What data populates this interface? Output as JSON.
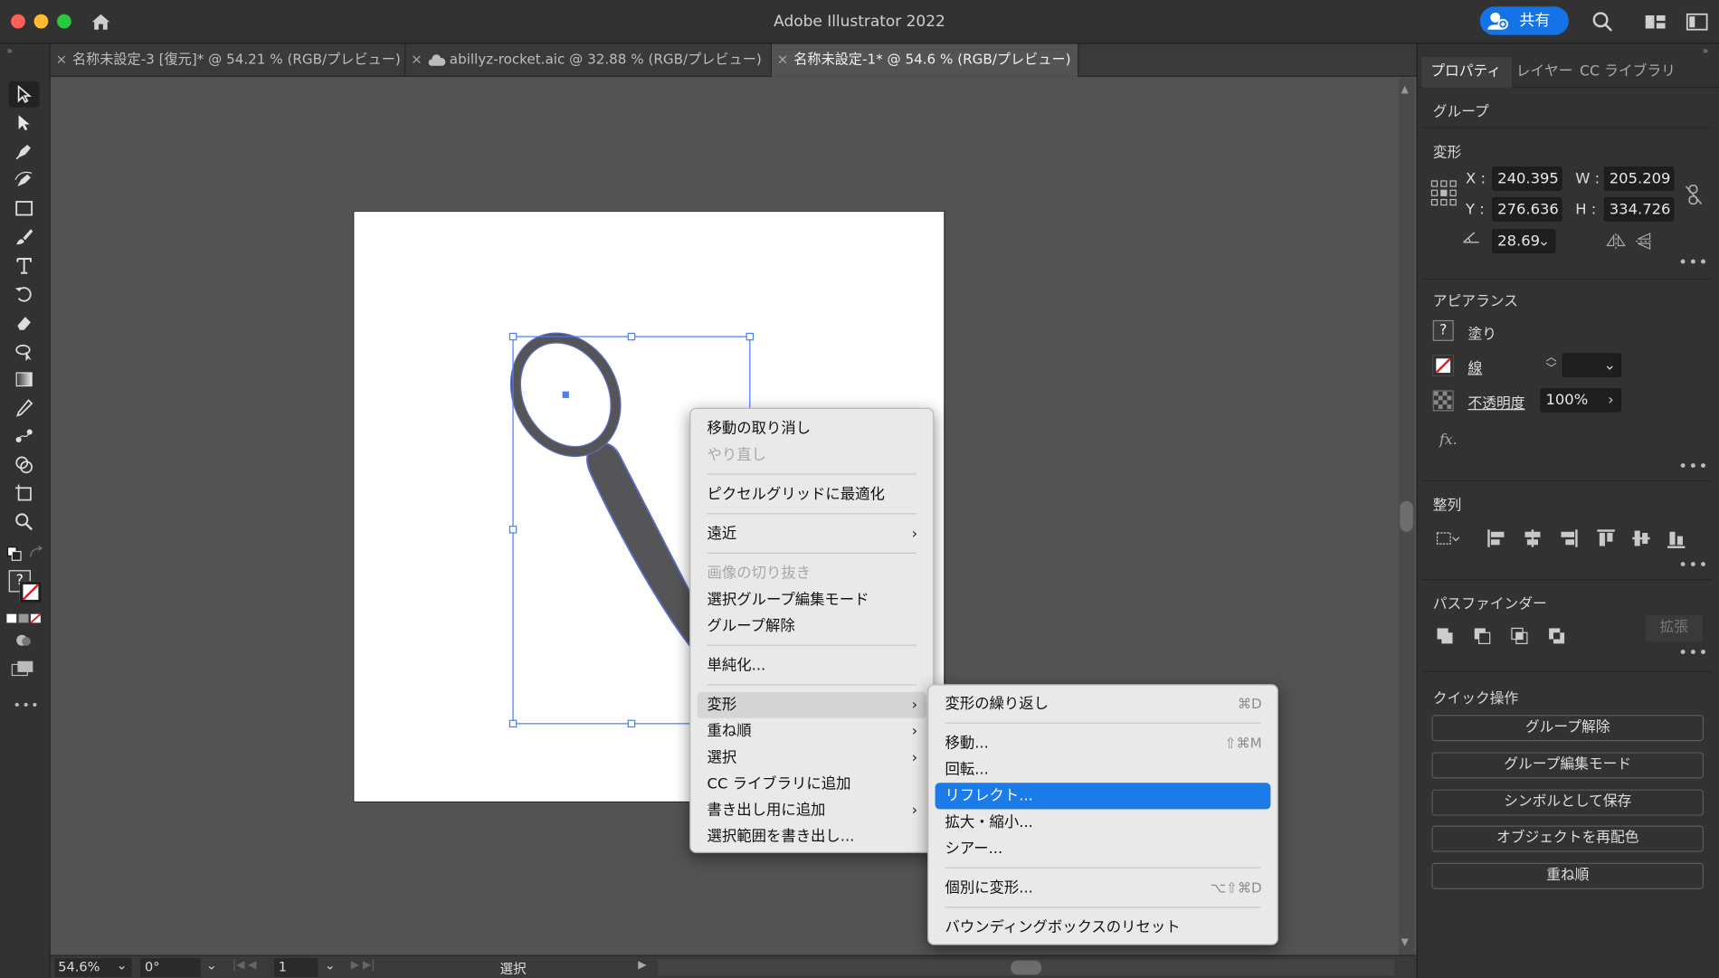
{
  "app": {
    "title": "Adobe Illustrator 2022",
    "share_label": "共有"
  },
  "tabs": [
    {
      "label": "名称未設定-3 [復元]* @ 54.21 % (RGB/プレビュー)",
      "close": "×"
    },
    {
      "label": "abillyz-rocket.aic @ 32.88 % (RGB/プレビュー)",
      "close": "×"
    },
    {
      "label": "名称未設定-1* @ 54.6 % (RGB/プレビュー)",
      "close": "×"
    }
  ],
  "tools": [
    "selection-tool-icon",
    "direct-selection-tool-icon",
    "pen-tool-icon",
    "curvature-tool-icon",
    "rectangle-tool-icon",
    "paintbrush-tool-icon",
    "type-tool-icon",
    "rotate-tool-icon",
    "eraser-tool-icon",
    "puppet-warp-tool-icon",
    "gradient-tool-icon",
    "eyedropper-tool-icon",
    "blend-tool-icon",
    "shape-builder-tool-icon",
    "artboard-tool-icon",
    "zoom-tool-icon"
  ],
  "toolbar_misc": {
    "fill_unknown": "?",
    "more": "•••"
  },
  "panel": {
    "tabs": [
      "プロパティ",
      "レイヤー",
      "CC ライブラリ"
    ],
    "object_type": "グループ",
    "transform": {
      "heading": "変形",
      "x_label": "X :",
      "x_value": "240.395",
      "y_label": "Y :",
      "y_value": "276.636",
      "w_label": "W :",
      "w_value": "205.209",
      "h_label": "H :",
      "h_value": "334.726",
      "angle_value": "28.69"
    },
    "appearance": {
      "heading": "アピアランス",
      "fill_icon": "?",
      "fill_label": "塗り",
      "stroke_label": "線",
      "opacity_label": "不透明度",
      "opacity_value": "100%",
      "fx_label": "fx."
    },
    "align": {
      "heading": "整列"
    },
    "pathfinder": {
      "heading": "パスファインダー",
      "expand_label": "拡張"
    },
    "quick_actions": {
      "heading": "クイック操作",
      "buttons": [
        "グループ解除",
        "グループ編集モード",
        "シンボルとして保存",
        "オブジェクトを再配色",
        "重ね順"
      ]
    }
  },
  "status": {
    "zoom": "54.6%",
    "rotation": "0°",
    "artboard_num": "1",
    "tool_name": "選択"
  },
  "context_menu": {
    "items": [
      {
        "label": "移動の取り消し"
      },
      {
        "label": "やり直し"
      },
      {
        "label": "ピクセルグリッドに最適化"
      },
      {
        "label": "遠近",
        "arrow": "›"
      },
      {
        "label": "画像の切り抜き"
      },
      {
        "label": "選択グループ編集モード"
      },
      {
        "label": "グループ解除"
      },
      {
        "label": "単純化..."
      },
      {
        "label": "変形",
        "arrow": "›"
      },
      {
        "label": "重ね順",
        "arrow": "›"
      },
      {
        "label": "選択",
        "arrow": "›"
      },
      {
        "label": "CC ライブラリに追加"
      },
      {
        "label": "書き出し用に追加",
        "arrow": "›"
      },
      {
        "label": "選択範囲を書き出し..."
      }
    ]
  },
  "submenu": {
    "items": [
      {
        "label": "変形の繰り返し",
        "shortcut": "⌘D"
      },
      {
        "label": "移動...",
        "shortcut": "⇧⌘M"
      },
      {
        "label": "回転..."
      },
      {
        "label": "リフレクト..."
      },
      {
        "label": "拡大・縮小..."
      },
      {
        "label": "シアー..."
      },
      {
        "label": "個別に変形...",
        "shortcut": "⌥⇧⌘D"
      },
      {
        "label": "バウンディングボックスのリセット"
      }
    ]
  },
  "colors": {
    "accent": "#1b7be8",
    "selection": "#4a7cff",
    "shape_fill": "#555557",
    "shape_stroke": "#5a6bc8"
  }
}
